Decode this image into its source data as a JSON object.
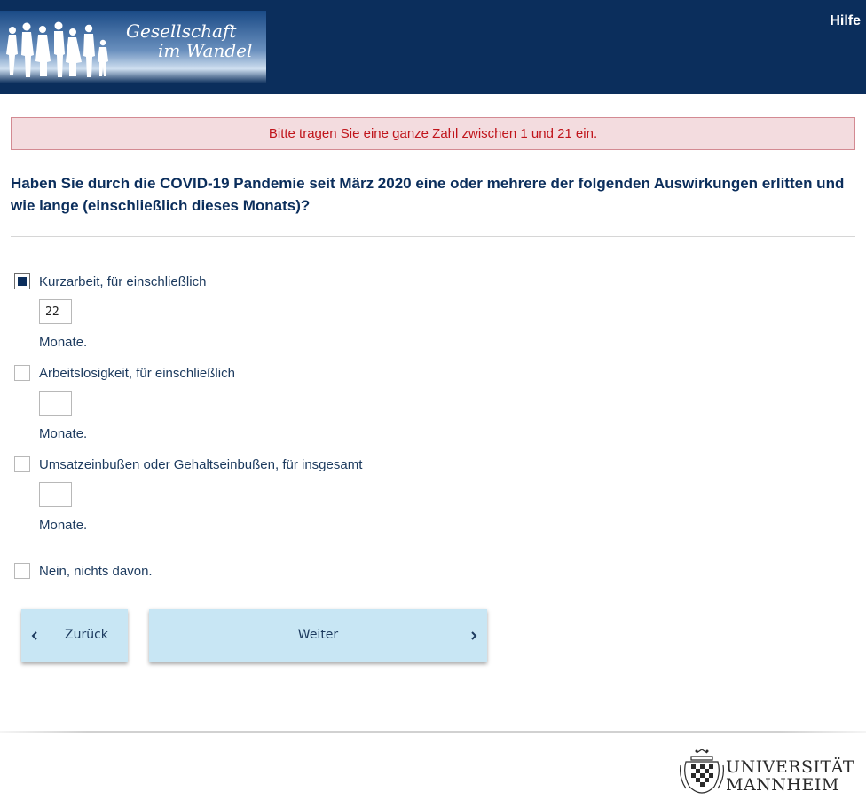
{
  "header": {
    "logo_text_line1": "Gesellschaft",
    "logo_text_line2": "im Wandel",
    "help_link": "Hilfe"
  },
  "error_message": "Bitte tragen Sie eine ganze Zahl zwischen 1 und 21 ein.",
  "question": "Haben Sie durch die COVID-19 Pandemie seit März 2020 eine oder mehrere der folgenden Auswirkungen erlitten und wie lange (einschließlich dieses Monats)?",
  "options": [
    {
      "label": "Kurzarbeit, für einschließlich",
      "checked": true,
      "value": "22",
      "unit": "Monate."
    },
    {
      "label": "Arbeitslosigkeit, für einschließlich",
      "checked": false,
      "value": "",
      "unit": "Monate."
    },
    {
      "label": "Umsatzeinbußen oder Gehaltseinbußen, für insgesamt",
      "checked": false,
      "value": "",
      "unit": "Monate."
    },
    {
      "label": "Nein, nichts davon.",
      "checked": false
    }
  ],
  "buttons": {
    "back_label": "Zurück",
    "next_label": "Weiter"
  },
  "footer": {
    "university_line1": "UNIVERSITÄT",
    "university_line2": "MANNHEIM"
  },
  "colors": {
    "header_bg": "#0b2e5c",
    "error_bg": "#f3dcdf",
    "error_text": "#c0141b",
    "button_bg": "#c8e6f4"
  },
  "icons": {
    "back": "chevron-left-icon",
    "next": "chevron-right-icon"
  }
}
